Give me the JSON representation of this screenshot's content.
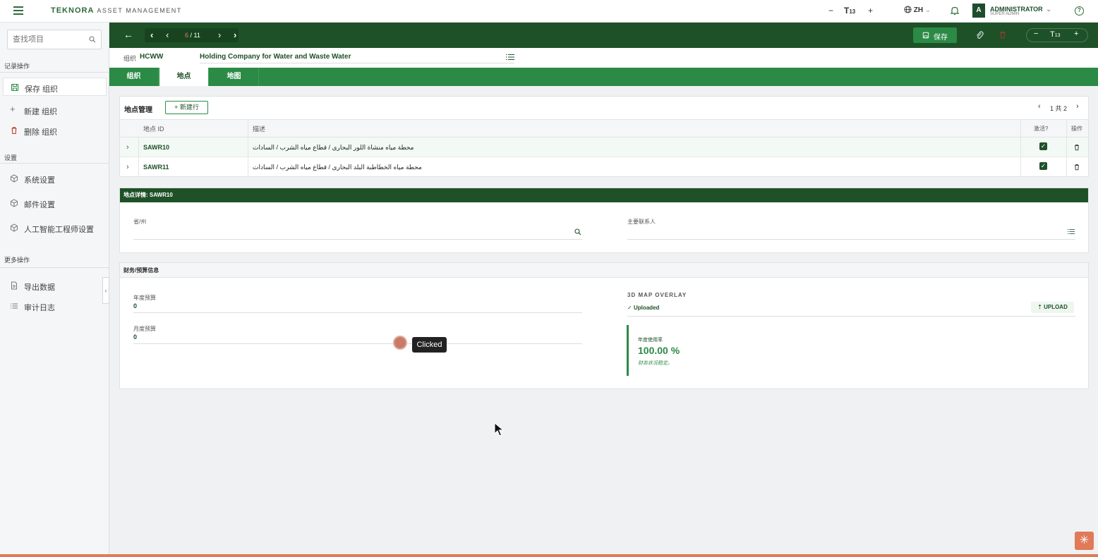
{
  "header": {
    "brand": "TEKNORA",
    "brand_suffix": "ASSET MANAGEMENT",
    "font_size": "13",
    "lang": "ZH",
    "user_initial": "A",
    "user_name": "ADMINISTRATOR",
    "user_role": "SUPER ADMIN"
  },
  "sidebar": {
    "search_placeholder": "查找项目",
    "sections": {
      "record": "记录操作",
      "settings": "设置",
      "more": "更多操作"
    },
    "record_items": [
      "保存 组织",
      "新建 组织",
      "删除 组织"
    ],
    "settings_items": [
      "系统设置",
      "邮件设置",
      "人工智能工程师设置"
    ],
    "more_items": [
      "导出数据",
      "审计日志"
    ]
  },
  "toolbar": {
    "page_current": "6",
    "page_total": "/ 11",
    "save_label": "保存",
    "font_size": "13"
  },
  "org": {
    "label": "组织",
    "code": "HCWW",
    "name": "Holding Company for Water and Waste Water"
  },
  "tabs": [
    "组织",
    "地点",
    "地图"
  ],
  "locations": {
    "title": "地点管理",
    "new_row": "+ 新建行",
    "pagination": "1 共 2",
    "columns": [
      "地点 ID",
      "描述",
      "激活?",
      "操作"
    ],
    "rows": [
      {
        "id": "SAWR10",
        "desc": "محطة مياه منشاة اللور البحارى / قطاع مياه الشرب / السادات",
        "active": true
      },
      {
        "id": "SAWR11",
        "desc": "محطة مياه الخطاطبة البلد البحارى / قطاع مياه الشرب / السادات",
        "active": true
      }
    ]
  },
  "detail": {
    "title": "地点详情: SAWR10",
    "province_label": "省/州",
    "contact_label": "主要联系人"
  },
  "finance": {
    "title": "财务/预算信息",
    "annual_label": "年度预算",
    "annual_value": "0",
    "monthly_label": "月度预算",
    "monthly_value": "0",
    "overlay_label": "3D MAP OVERLAY",
    "overlay_status": "Uploaded",
    "upload_label": "UPLOAD",
    "util_label": "年度使用率",
    "util_value": "100.00 %",
    "util_note": "财务状况稳定。"
  },
  "overlay": {
    "click_label": "Clicked"
  },
  "colors": {
    "primary_dark": "#1e5128",
    "primary": "#2b8a45",
    "accent": "#e07a58"
  }
}
